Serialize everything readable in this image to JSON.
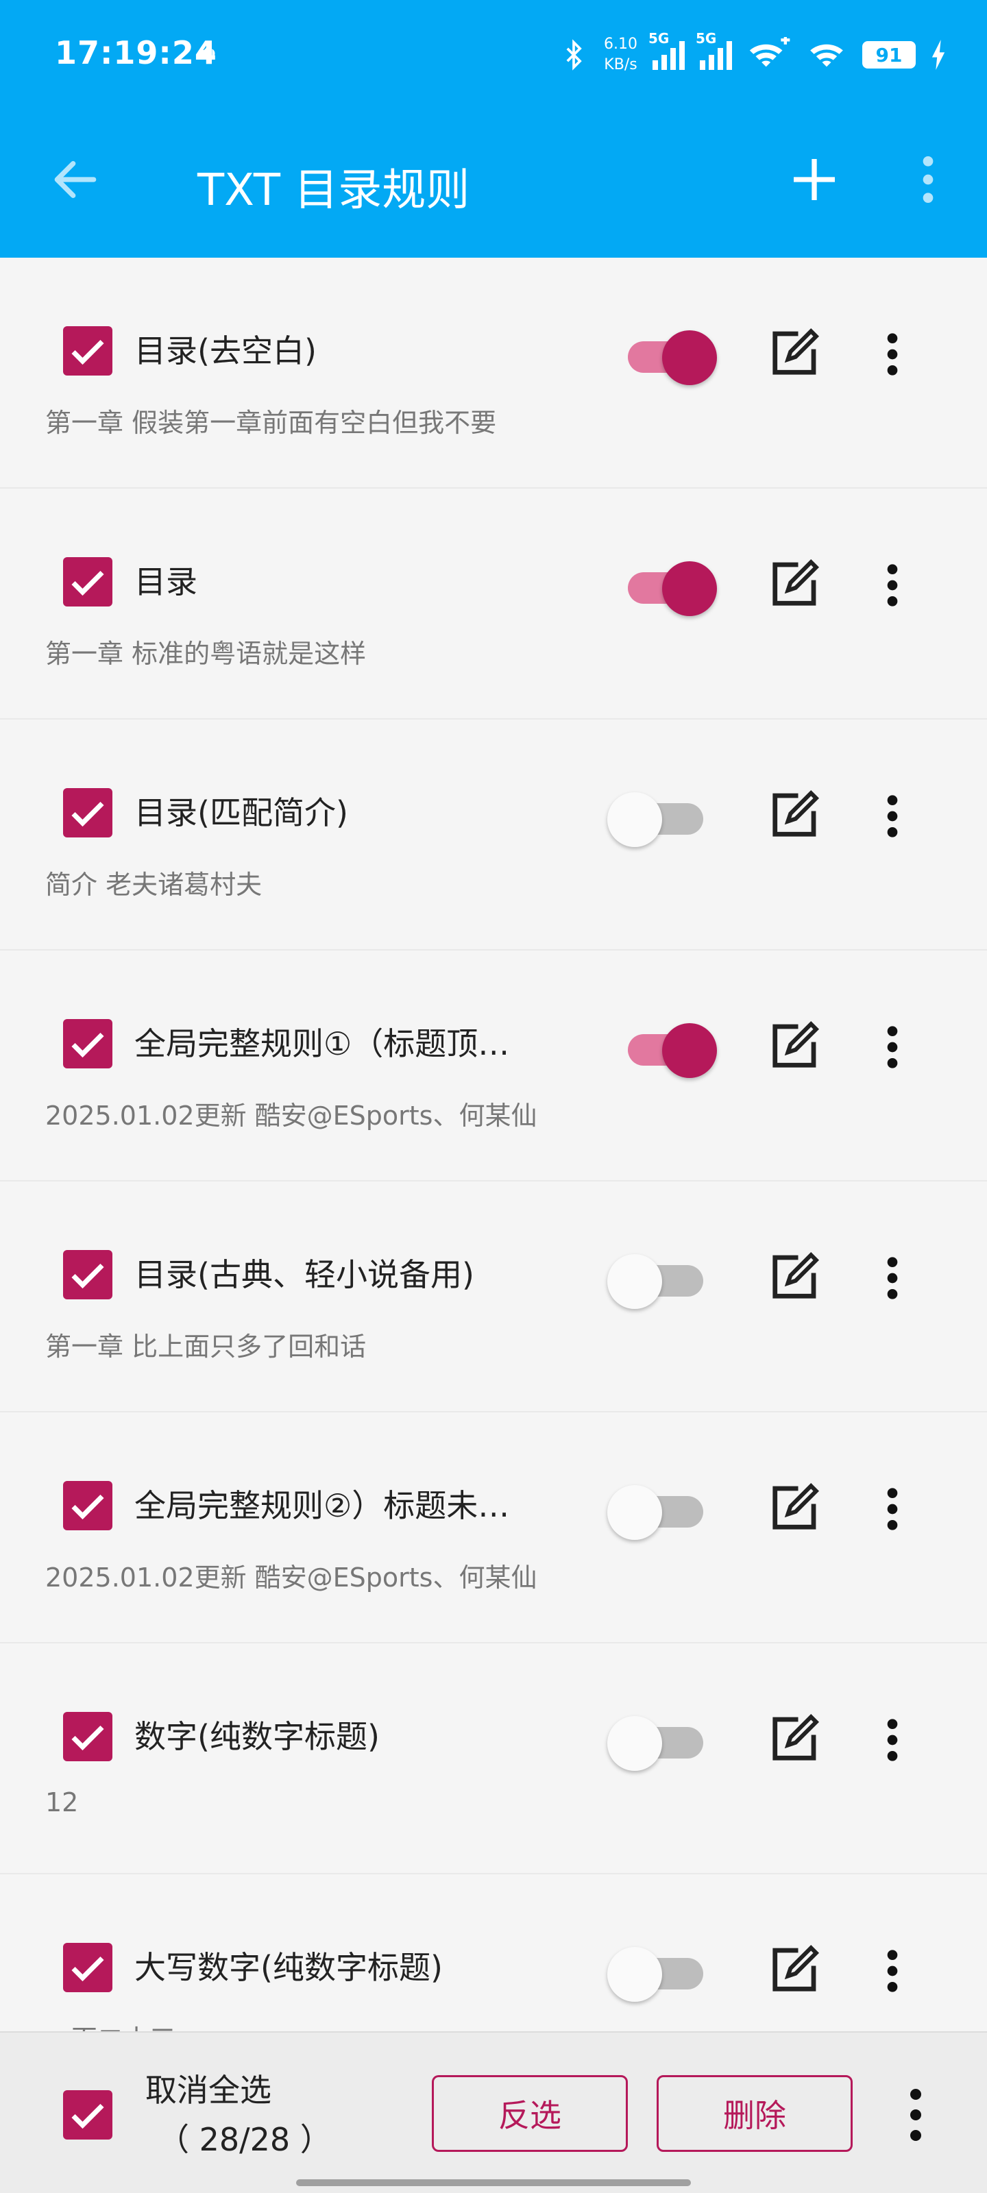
{
  "status_bar": {
    "time": "17:19:24",
    "net_speed_value": "6.10",
    "net_speed_unit": "KB/s",
    "sim1_label": "5G",
    "sim2_label": "5G",
    "battery": "91"
  },
  "toolbar": {
    "title": "TXT 目录规则"
  },
  "rules": [
    {
      "title": "目录(去空白)",
      "subtitle": "第一章 假装第一章前面有空白但我不要",
      "checked": true,
      "enabled": true
    },
    {
      "title": "目录",
      "subtitle": "第一章 标准的粤语就是这样",
      "checked": true,
      "enabled": true
    },
    {
      "title": "目录(匹配简介)",
      "subtitle": "简介 老夫诸葛村夫",
      "checked": true,
      "enabled": false
    },
    {
      "title": "全局完整规则①（标题顶…",
      "subtitle": "2025.01.02更新  酷安@ESports、何某仙",
      "checked": true,
      "enabled": true
    },
    {
      "title": "目录(古典、轻小说备用)",
      "subtitle": "第一章 比上面只多了回和话",
      "checked": true,
      "enabled": false
    },
    {
      "title": "全局完整规则②）标题未…",
      "subtitle": "2025.01.02更新  酷安@ESports、何某仙",
      "checked": true,
      "enabled": false
    },
    {
      "title": "数字(纯数字标题)",
      "subtitle": "12",
      "checked": true,
      "enabled": false
    },
    {
      "title": "大写数字(纯数字标题)",
      "subtitle": "一百二十三",
      "checked": true,
      "enabled": false
    }
  ],
  "bottom_bar": {
    "deselect_all_label": "取消全选",
    "selection_count": "（ 28/28 ）",
    "invert_label": "反选",
    "delete_label": "删除"
  },
  "colors": {
    "primary": "#03a9f4",
    "accent": "#b5195a",
    "accent_light": "#e2789f",
    "background": "#f5f5f5"
  }
}
